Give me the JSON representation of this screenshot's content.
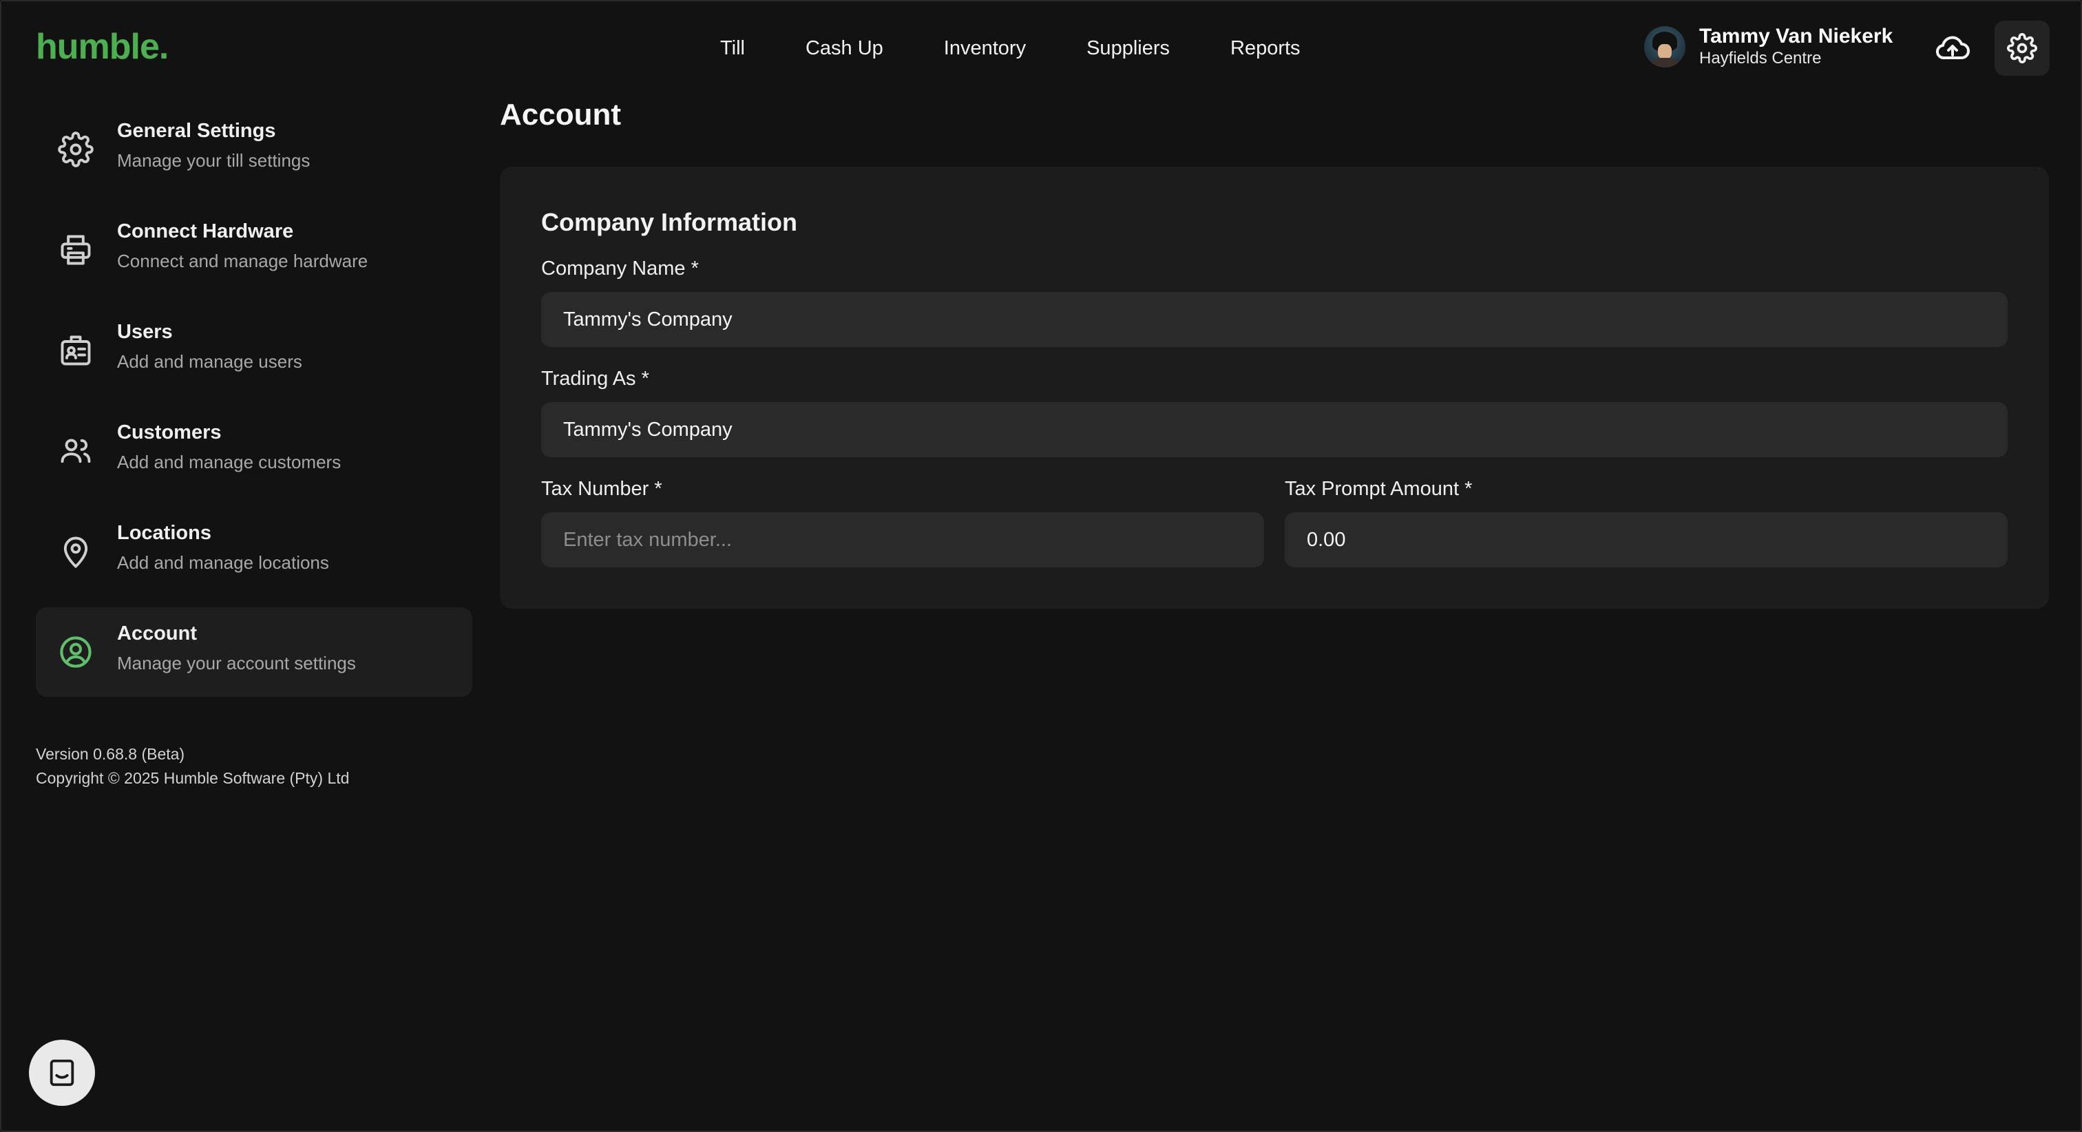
{
  "app": {
    "logo_text": "humble.",
    "brand_color": "#4caf50"
  },
  "topnav": {
    "items": [
      {
        "label": "Till"
      },
      {
        "label": "Cash Up"
      },
      {
        "label": "Inventory"
      },
      {
        "label": "Suppliers"
      },
      {
        "label": "Reports"
      }
    ]
  },
  "user": {
    "name": "Tammy Van Niekerk",
    "location": "Hayfields Centre"
  },
  "icons": {
    "sync": "cloud-upload-icon",
    "settings": "gear-icon"
  },
  "sidebar": {
    "items": [
      {
        "title": "General Settings",
        "subtitle": "Manage your till settings",
        "icon": "gear-icon",
        "active": false
      },
      {
        "title": "Connect Hardware",
        "subtitle": "Connect and manage hardware",
        "icon": "printer-icon",
        "active": false
      },
      {
        "title": "Users",
        "subtitle": "Add and manage users",
        "icon": "id-badge-icon",
        "active": false
      },
      {
        "title": "Customers",
        "subtitle": "Add and manage customers",
        "icon": "people-icon",
        "active": false
      },
      {
        "title": "Locations",
        "subtitle": "Add and manage locations",
        "icon": "map-pin-icon",
        "active": false
      },
      {
        "title": "Account",
        "subtitle": "Manage your account settings",
        "icon": "user-circle-icon",
        "active": true
      }
    ],
    "version": "Version 0.68.8 (Beta)",
    "copyright": "Copyright © 2025 Humble Software (Pty) Ltd"
  },
  "main": {
    "title": "Account",
    "section_title": "Company Information",
    "fields": {
      "company_name": {
        "label": "Company Name *",
        "value": "Tammy's Company",
        "placeholder": ""
      },
      "trading_as": {
        "label": "Trading As *",
        "value": "Tammy's Company",
        "placeholder": ""
      },
      "tax_number": {
        "label": "Tax Number *",
        "value": "",
        "placeholder": "Enter tax number..."
      },
      "tax_prompt_amount": {
        "label": "Tax Prompt Amount *",
        "value": "0.00",
        "placeholder": ""
      }
    }
  },
  "chat": {
    "icon": "chat-icon"
  }
}
